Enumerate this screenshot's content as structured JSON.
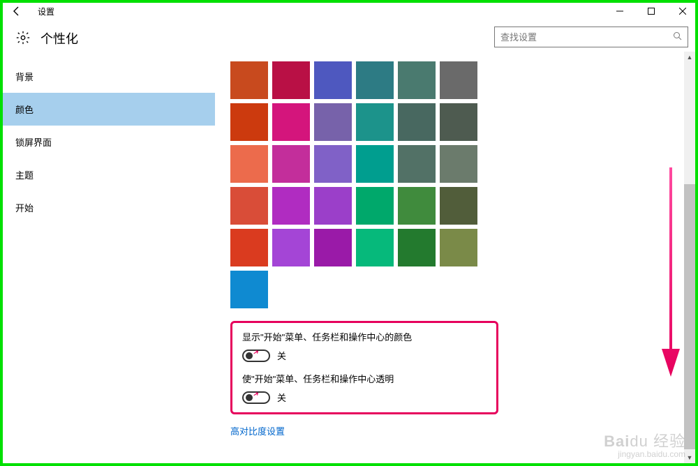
{
  "titlebar": {
    "title": "设置"
  },
  "header": {
    "title": "个性化"
  },
  "search": {
    "placeholder": "查找设置"
  },
  "sidebar": {
    "items": [
      {
        "label": "背景",
        "active": false
      },
      {
        "label": "颜色",
        "active": true
      },
      {
        "label": "锁屏界面",
        "active": false
      },
      {
        "label": "主题",
        "active": false
      },
      {
        "label": "开始",
        "active": false
      }
    ]
  },
  "palette": {
    "rows": [
      [
        "#c84a1e",
        "#b91045",
        "#4e58bf",
        "#2d7b84",
        "#4a7a6f",
        "#6a6a6a"
      ],
      [
        "#cc3a0e",
        "#d4157c",
        "#7762aa",
        "#1c938b",
        "#486860",
        "#4e5b50"
      ],
      [
        "#ec6b4c",
        "#c32e9b",
        "#8061c7",
        "#009e8f",
        "#527166",
        "#6b7b6c"
      ],
      [
        "#d94d38",
        "#b02cc1",
        "#9b3fc9",
        "#00a86b",
        "#408b3d",
        "#515d3a"
      ],
      [
        "#da3b1f",
        "#a445d6",
        "#9a1aa8",
        "#06b97b",
        "#237a2e",
        "#7a8a48"
      ]
    ],
    "extra": "#0f8ad1"
  },
  "toggles": {
    "show_color": {
      "label": "显示\"开始\"菜单、任务栏和操作中心的颜色",
      "state": "关"
    },
    "transparent": {
      "label": "使\"开始\"菜单、任务栏和操作中心透明",
      "state": "关"
    }
  },
  "high_contrast_link": "高对比度设置",
  "watermark": {
    "line1_a": "Bai",
    "line1_b": "du",
    "line1_c": "经验",
    "line2": "jingyan.baidu.com"
  }
}
